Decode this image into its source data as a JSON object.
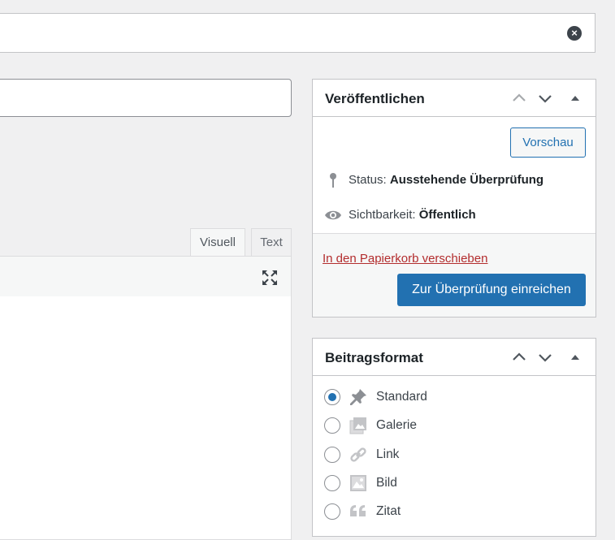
{
  "editor": {
    "tabs": [
      {
        "label": "Visuell",
        "active": true
      },
      {
        "label": "Text",
        "active": false
      }
    ],
    "fullscreen_icon": "fullscreen-icon"
  },
  "publish": {
    "title": "Veröffentlichen",
    "preview_label": "Vorschau",
    "status_label": "Status:",
    "status_value": "Ausstehende Überprüfung",
    "visibility_label": "Sichtbarkeit:",
    "visibility_value": "Öffentlich",
    "trash_label": "In den Papierkorb verschieben",
    "submit_label": "Zur Überprüfung einreichen"
  },
  "post_format": {
    "title": "Beitragsformat",
    "selected": "Standard",
    "options": [
      {
        "label": "Standard",
        "icon": "pin-icon"
      },
      {
        "label": "Galerie",
        "icon": "gallery-icon"
      },
      {
        "label": "Link",
        "icon": "link-icon"
      },
      {
        "label": "Bild",
        "icon": "image-icon"
      },
      {
        "label": "Zitat",
        "icon": "quote-icon"
      }
    ]
  },
  "colors": {
    "accent": "#2271b1",
    "danger": "#b32d2e",
    "background": "#f0f0f1"
  }
}
